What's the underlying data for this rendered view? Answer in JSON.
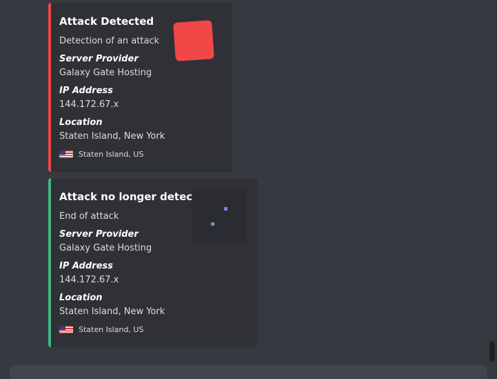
{
  "embeds": [
    {
      "title": "Attack Detected",
      "description": "Detection of an attack",
      "accent_color": "#f04747",
      "fields": [
        {
          "name": "Server Provider",
          "value": "Galaxy Gate Hosting"
        },
        {
          "name": "IP Address",
          "value": "144.172.67.x"
        },
        {
          "name": "Location",
          "value": "Staten Island, New York"
        }
      ],
      "footer": {
        "icon": "us-flag-icon",
        "text": "Staten Island, US"
      }
    },
    {
      "title": "Attack no longer detected",
      "description": "End of attack",
      "accent_color": "#43b581",
      "fields": [
        {
          "name": "Server Provider",
          "value": "Galaxy Gate Hosting"
        },
        {
          "name": "IP Address",
          "value": "144.172.67.x"
        },
        {
          "name": "Location",
          "value": "Staten Island, New York"
        }
      ],
      "footer": {
        "icon": "us-flag-icon",
        "text": "Staten Island, US"
      }
    }
  ],
  "colors": {
    "background": "#36393f",
    "embed_background": "#2f3136"
  }
}
